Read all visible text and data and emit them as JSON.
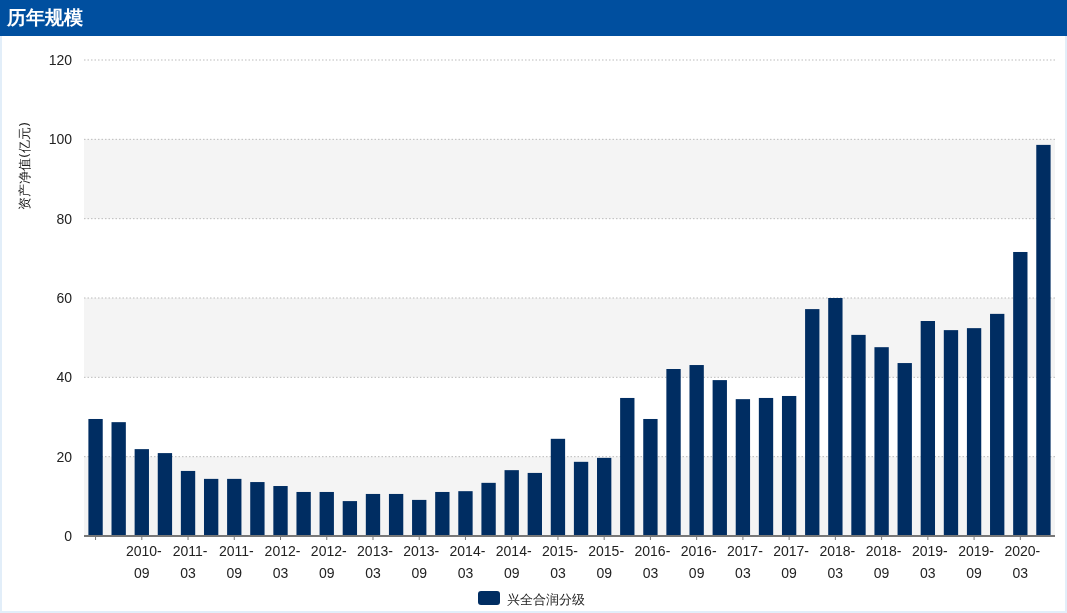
{
  "header": {
    "title": "历年规模"
  },
  "chart": {
    "chart_data": {
      "type": "bar",
      "ylabel": "资产净值(亿元)",
      "categories": [
        null,
        null,
        "2010-09",
        null,
        "2011-03",
        null,
        "2011-09",
        null,
        "2012-03",
        null,
        "2012-09",
        null,
        "2013-03",
        null,
        "2013-09",
        null,
        "2014-03",
        null,
        "2014-09",
        null,
        "2015-03",
        null,
        "2015-09",
        null,
        "2016-03",
        null,
        "2016-09",
        null,
        "2017-03",
        null,
        "2017-09",
        null,
        "2018-03",
        null,
        "2018-09",
        null,
        "2019-03",
        null,
        "2019-09",
        null,
        "2020-03",
        null
      ],
      "series": [
        {
          "name": "兴全合润分级",
          "color": "#002d62",
          "values": [
            29.5,
            28.7,
            21.9,
            20.9,
            16.4,
            14.4,
            14.4,
            13.6,
            12.6,
            11.1,
            11.1,
            8.8,
            10.6,
            10.6,
            9.1,
            11.1,
            11.3,
            13.4,
            16.6,
            15.9,
            24.5,
            18.7,
            19.7,
            34.8,
            29.5,
            42.1,
            43.1,
            39.3,
            34.5,
            34.8,
            35.3,
            57.2,
            60.0,
            50.7,
            47.6,
            43.6,
            54.2,
            51.9,
            52.4,
            56.0,
            71.6,
            98.6
          ]
        }
      ],
      "ylim": [
        0,
        120
      ],
      "grid": true,
      "yticks": [
        0,
        20,
        40,
        60,
        80,
        100,
        120
      ]
    }
  }
}
